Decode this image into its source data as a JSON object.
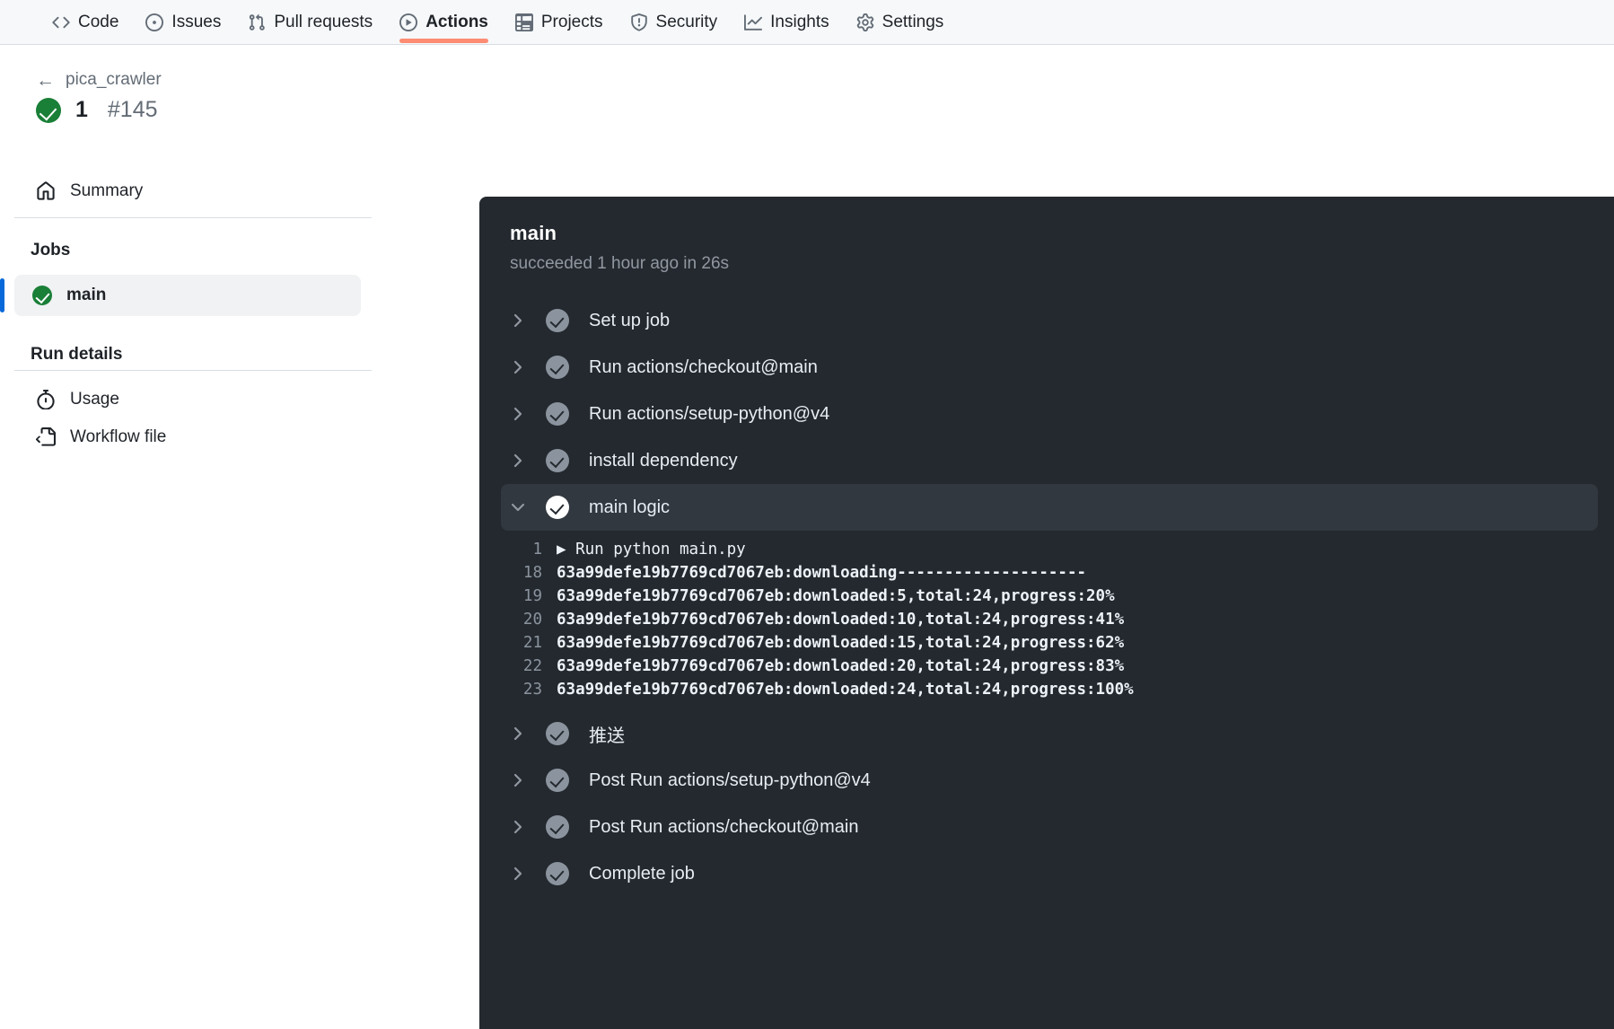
{
  "nav": {
    "items": [
      {
        "label": "Code",
        "icon": "code-icon",
        "active": false
      },
      {
        "label": "Issues",
        "icon": "issue-opened-icon",
        "active": false
      },
      {
        "label": "Pull requests",
        "icon": "git-pull-request-icon",
        "active": false
      },
      {
        "label": "Actions",
        "icon": "play-icon",
        "active": true
      },
      {
        "label": "Projects",
        "icon": "table-icon",
        "active": false
      },
      {
        "label": "Security",
        "icon": "shield-icon",
        "active": false
      },
      {
        "label": "Insights",
        "icon": "graph-icon",
        "active": false
      },
      {
        "label": "Settings",
        "icon": "gear-icon",
        "active": false
      }
    ],
    "accent_underline": "#fd8c73"
  },
  "sidebar": {
    "back_label": "pica_crawler",
    "run_name": "1",
    "run_number": "#145",
    "run_status_color": "#1a7f37",
    "summary_label": "Summary",
    "jobs_heading": "Jobs",
    "jobs": [
      {
        "label": "main",
        "status": "success",
        "selected": true
      }
    ],
    "selected_indicator_color": "#0969da",
    "run_details_heading": "Run details",
    "run_details": [
      {
        "label": "Usage",
        "icon": "stopwatch-icon"
      },
      {
        "label": "Workflow file",
        "icon": "file-code-icon"
      }
    ]
  },
  "log": {
    "job_name": "main",
    "job_status": "succeeded 1 hour ago in 26s",
    "background": "#24292f",
    "highlight": "#32383f",
    "steps": [
      {
        "label": "Set up job",
        "expanded": false,
        "status": "success"
      },
      {
        "label": "Run actions/checkout@main",
        "expanded": false,
        "status": "success"
      },
      {
        "label": "Run actions/setup-python@v4",
        "expanded": false,
        "status": "success"
      },
      {
        "label": "install dependency",
        "expanded": false,
        "status": "success"
      },
      {
        "label": "main logic",
        "expanded": true,
        "status": "success"
      },
      {
        "label": "推送",
        "expanded": false,
        "status": "success"
      },
      {
        "label": "Post Run actions/setup-python@v4",
        "expanded": false,
        "status": "success"
      },
      {
        "label": "Post Run actions/checkout@main",
        "expanded": false,
        "status": "success"
      },
      {
        "label": "Complete job",
        "expanded": false,
        "status": "success"
      }
    ],
    "output_lines": [
      {
        "num": "1",
        "text": "▶ Run python main.py",
        "first": true
      },
      {
        "num": "18",
        "text": "63a99defe19b7769cd7067eb:downloading--------------------"
      },
      {
        "num": "19",
        "text": "63a99defe19b7769cd7067eb:downloaded:5,total:24,progress:20%"
      },
      {
        "num": "20",
        "text": "63a99defe19b7769cd7067eb:downloaded:10,total:24,progress:41%"
      },
      {
        "num": "21",
        "text": "63a99defe19b7769cd7067eb:downloaded:15,total:24,progress:62%"
      },
      {
        "num": "22",
        "text": "63a99defe19b7769cd7067eb:downloaded:20,total:24,progress:83%"
      },
      {
        "num": "23",
        "text": "63a99defe19b7769cd7067eb:downloaded:24,total:24,progress:100%"
      }
    ]
  }
}
